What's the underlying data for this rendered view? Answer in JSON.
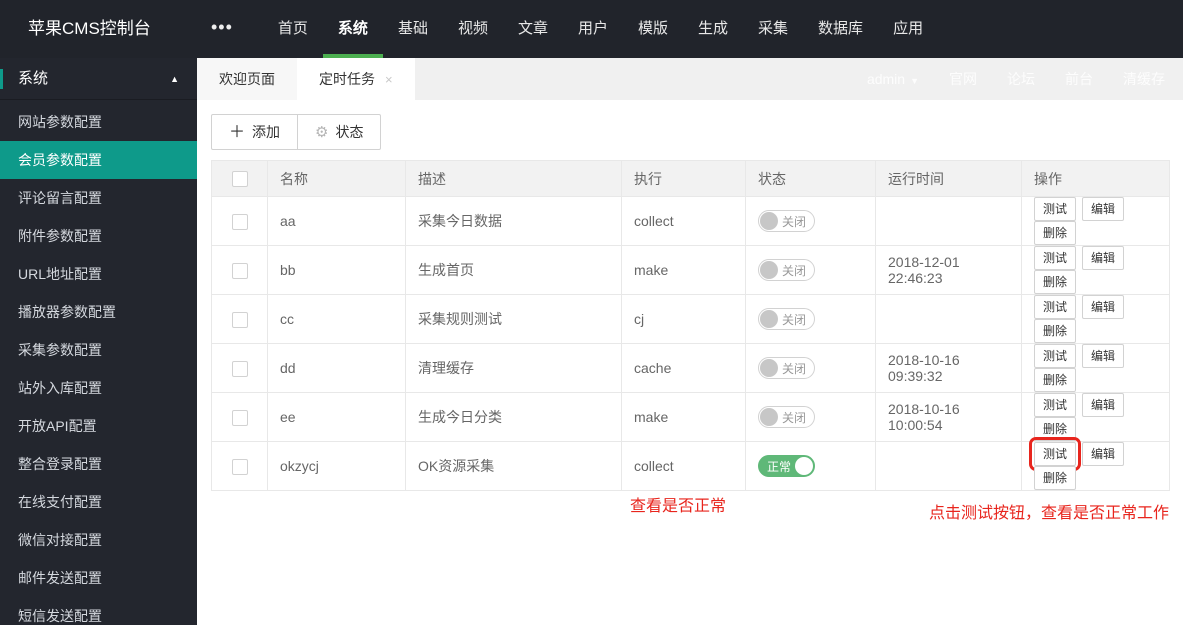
{
  "topbar": {
    "title": "苹果CMS控制台",
    "collapse_icon": "•••",
    "nav": [
      {
        "label": "首页",
        "active": false
      },
      {
        "label": "系统",
        "active": true
      },
      {
        "label": "基础",
        "active": false
      },
      {
        "label": "视频",
        "active": false
      },
      {
        "label": "文章",
        "active": false
      },
      {
        "label": "用户",
        "active": false
      },
      {
        "label": "模版",
        "active": false
      },
      {
        "label": "生成",
        "active": false
      },
      {
        "label": "采集",
        "active": false
      },
      {
        "label": "数据库",
        "active": false
      },
      {
        "label": "应用",
        "active": false
      }
    ]
  },
  "sidebar": {
    "group_title": "系统",
    "collapse_caret": "▲",
    "items": [
      {
        "label": "网站参数配置",
        "active": false
      },
      {
        "label": "会员参数配置",
        "active": true
      },
      {
        "label": "评论留言配置",
        "active": false
      },
      {
        "label": "附件参数配置",
        "active": false
      },
      {
        "label": "URL地址配置",
        "active": false
      },
      {
        "label": "播放器参数配置",
        "active": false
      },
      {
        "label": "采集参数配置",
        "active": false
      },
      {
        "label": "站外入库配置",
        "active": false
      },
      {
        "label": "开放API配置",
        "active": false
      },
      {
        "label": "整合登录配置",
        "active": false
      },
      {
        "label": "在线支付配置",
        "active": false
      },
      {
        "label": "微信对接配置",
        "active": false
      },
      {
        "label": "邮件发送配置",
        "active": false
      },
      {
        "label": "短信发送配置",
        "active": false
      }
    ]
  },
  "tabs": [
    {
      "label": "欢迎页面",
      "active": false,
      "closable": false
    },
    {
      "label": "定时任务",
      "active": true,
      "closable": true,
      "close_icon": "×"
    }
  ],
  "userbar": {
    "user": "admin",
    "caret": "▼",
    "links": [
      "官网",
      "论坛",
      "前台",
      "清缓存"
    ]
  },
  "toolbar": {
    "add_label": "添加",
    "plus_icon": "＋",
    "status_label": "状态",
    "gear_icon": "⚙"
  },
  "table": {
    "headers": [
      "名称",
      "描述",
      "执行",
      "状态",
      "运行时间",
      "操作"
    ],
    "action_labels": [
      "测试",
      "编辑",
      "删除"
    ],
    "rows": [
      {
        "name": "aa",
        "desc": "采集今日数据",
        "exec": "collect",
        "status": "off",
        "status_label": "关闭",
        "time": "",
        "highlight_test": false
      },
      {
        "name": "bb",
        "desc": "生成首页",
        "exec": "make",
        "status": "off",
        "status_label": "关闭",
        "time": "2018-12-01 22:46:23",
        "highlight_test": false
      },
      {
        "name": "cc",
        "desc": "采集规则测试",
        "exec": "cj",
        "status": "off",
        "status_label": "关闭",
        "time": "",
        "highlight_test": false
      },
      {
        "name": "dd",
        "desc": "清理缓存",
        "exec": "cache",
        "status": "off",
        "status_label": "关闭",
        "time": "2018-10-16 09:39:32",
        "highlight_test": false
      },
      {
        "name": "ee",
        "desc": "生成今日分类",
        "exec": "make",
        "status": "off",
        "status_label": "关闭",
        "time": "2018-10-16 10:00:54",
        "highlight_test": false
      },
      {
        "name": "okzycj",
        "desc": "OK资源采集",
        "exec": "collect",
        "status": "on",
        "status_label": "正常",
        "time": "",
        "highlight_test": true
      }
    ]
  },
  "annotations": {
    "note1": "查看是否正常",
    "note2": "点击测试按钮，查看是否正常工作"
  },
  "colors": {
    "topbar_bg": "#21242b",
    "sidebar_bg": "#23262e",
    "nav_underline_green": "#4caf50",
    "sidebar_active_teal": "#0e9a8a",
    "toggle_on_green": "#5FB878",
    "annotation_red": "#e8251d"
  }
}
